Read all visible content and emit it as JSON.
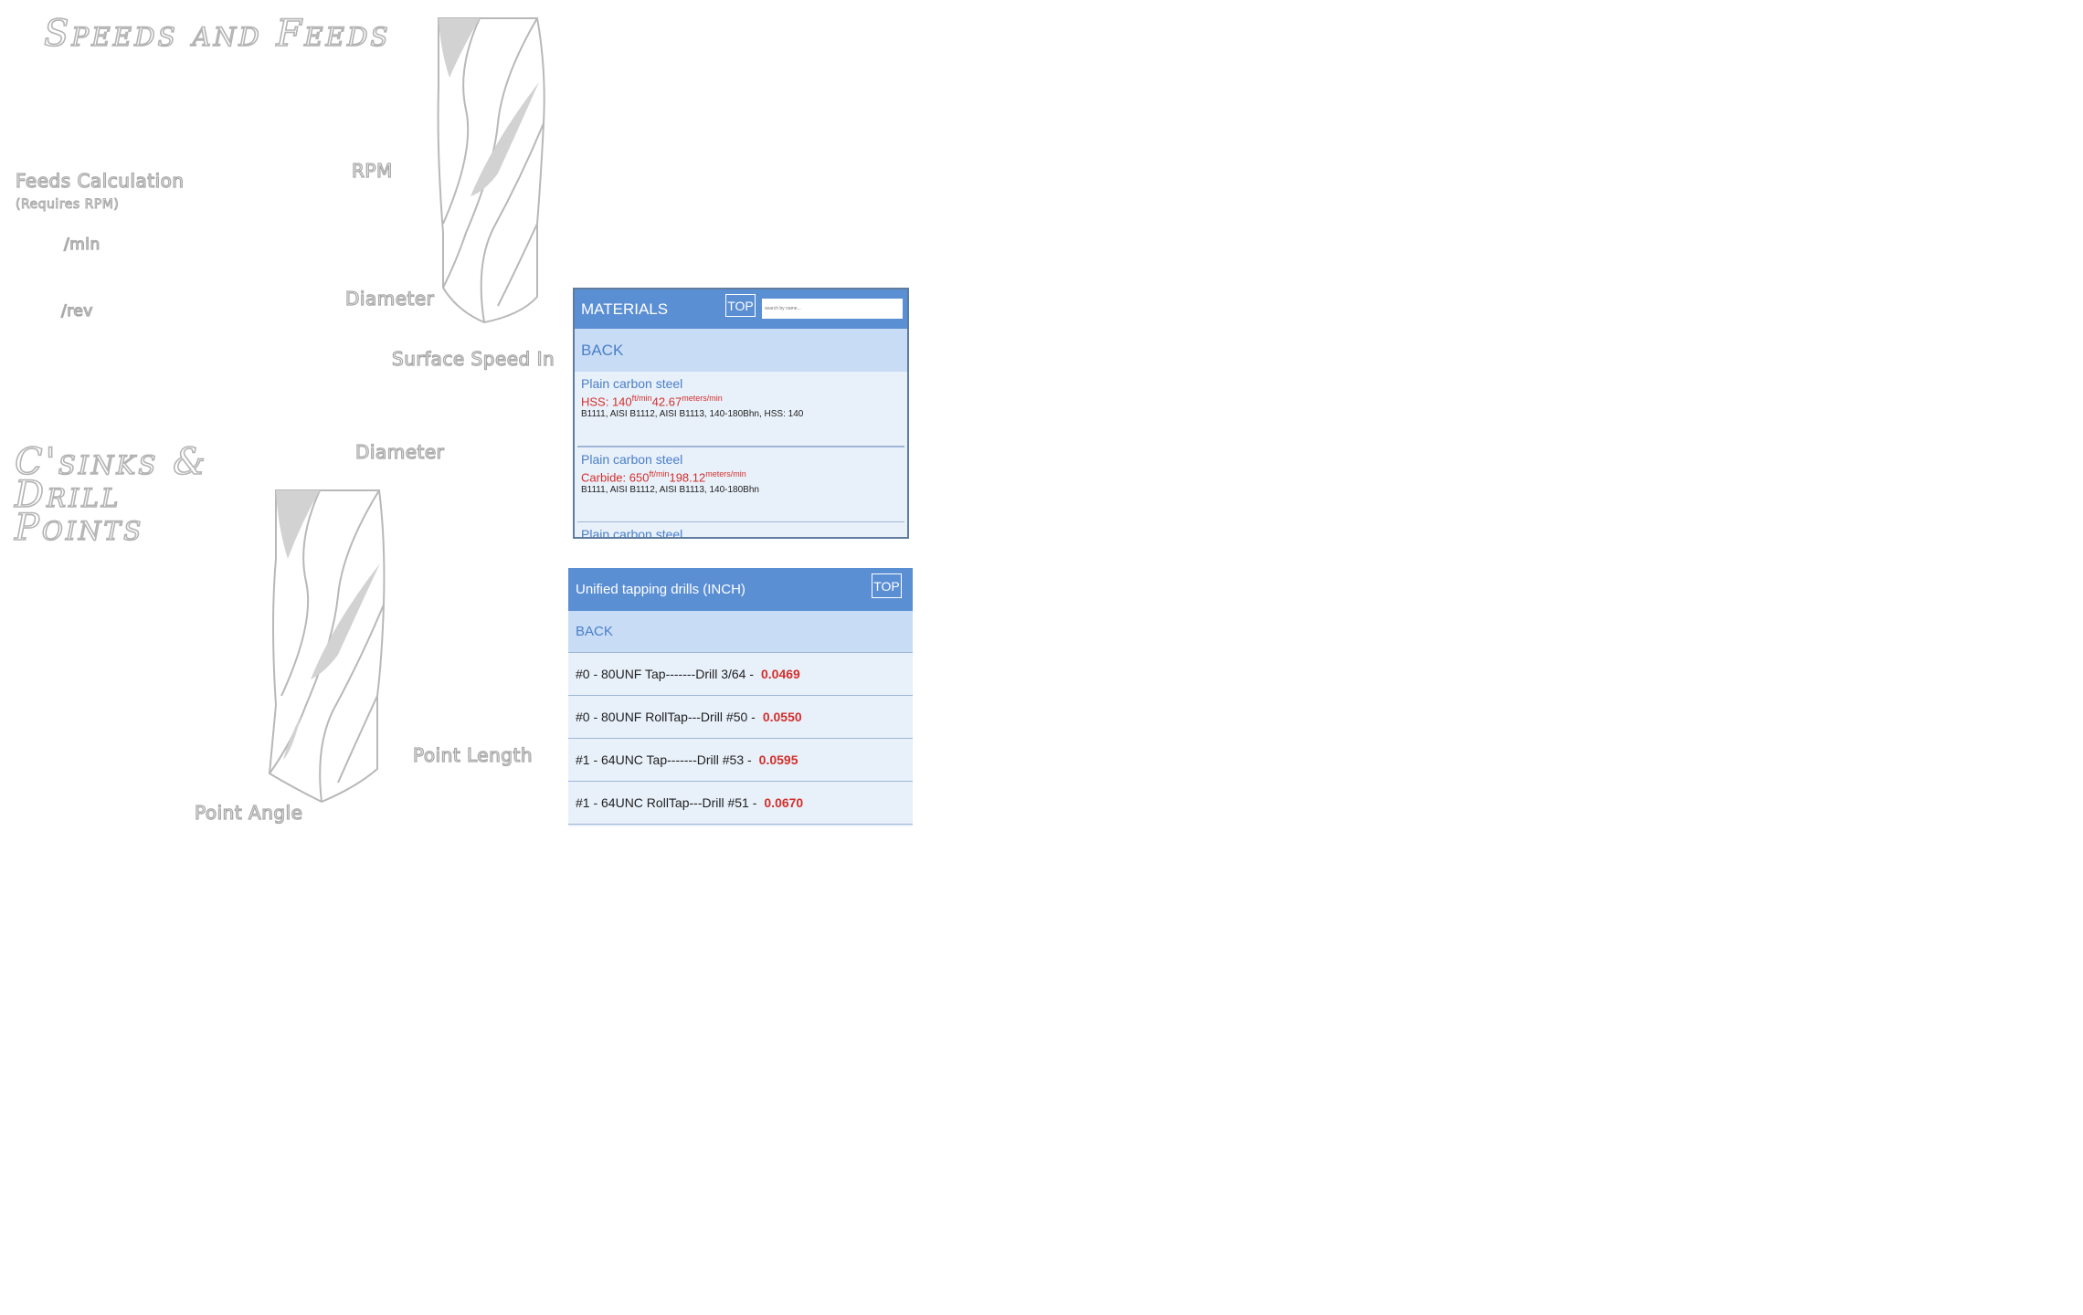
{
  "app": {
    "title": "Speeds and Feeds",
    "section2_title": "C'sinks & Drill Points"
  },
  "labels": {
    "feeds_calc": "Feeds Calculation",
    "requires_rpm": "(Requires RPM)",
    "per_min": "/min",
    "per_rev": "/rev",
    "rpm": "RPM",
    "diameter": "Diameter",
    "surface_speed": "Surface Speed In",
    "diameter2": "Diameter",
    "point_length": "Point Length",
    "point_angle": "Point Angle"
  },
  "materials": {
    "header": "MATERIALS",
    "top_label": "TOP",
    "search_placeholder": "search by name...",
    "back_label": "BACK",
    "items": [
      {
        "name": "Plain carbon steel",
        "speed": "HSS: 140",
        "unit1": "ft/min",
        "metric": "42.67",
        "unit2": "meters/min",
        "grades": "B1111, AISI B1112, AISI B1113, 140-180Bhn, HSS: 140"
      },
      {
        "name": "Plain carbon steel",
        "speed": "Carbide: 650",
        "unit1": "ft/min",
        "metric": "198.12",
        "unit2": "meters/min",
        "grades": "B1111, AISI B1112, AISI B1113, 140-180Bhn"
      },
      {
        "name": "Plain carbon steel"
      }
    ]
  },
  "tapping": {
    "header": "Unified tapping drills (INCH)",
    "top_label": "TOP",
    "back_label": "BACK",
    "rows": [
      {
        "desc": "#0 - 80UNF Tap-------Drill 3/64 -",
        "value": "0.0469"
      },
      {
        "desc": "#0 - 80UNF RollTap---Drill #50 -",
        "value": "0.0550"
      },
      {
        "desc": "#1 - 64UNC Tap-------Drill #53 -",
        "value": "0.0595"
      },
      {
        "desc": "#1 - 64UNC RollTap---Drill #51 -",
        "value": "0.0670"
      }
    ]
  },
  "colors": {
    "header_blue": "#5b8fd4",
    "back_row": "#c8dcf6",
    "panel_bg": "#e8f0fa",
    "value_red": "#d4302a"
  }
}
